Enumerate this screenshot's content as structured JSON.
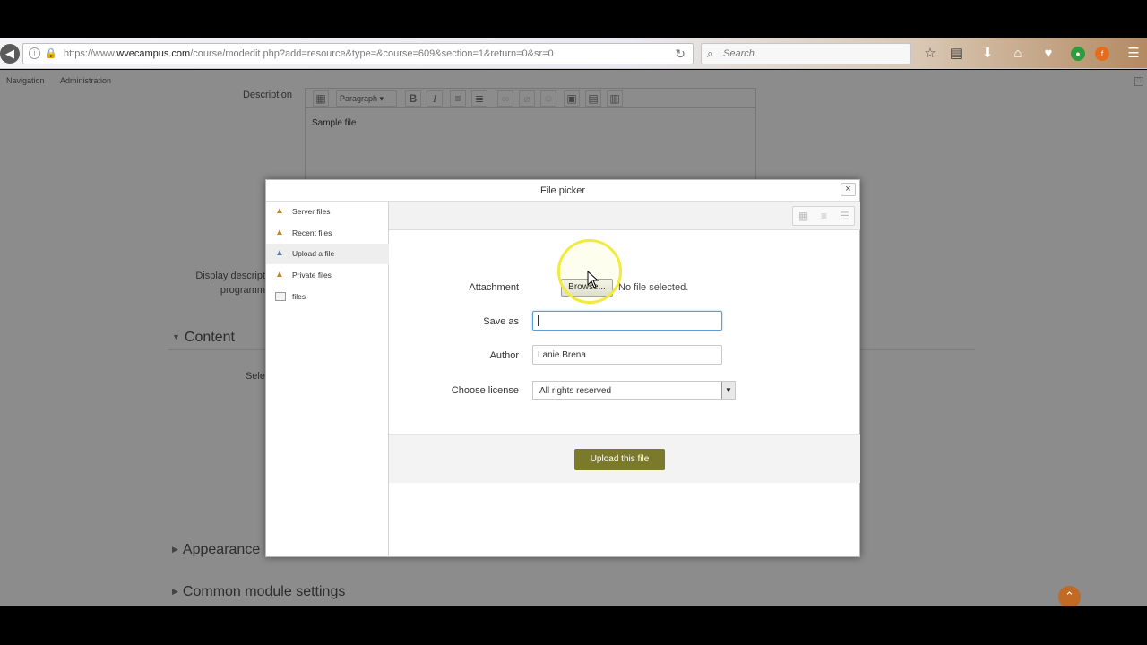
{
  "browser": {
    "url_prefix": "https://www.",
    "url_domain": "wvecampus.com",
    "url_path": "/course/modedit.php?add=resource&type=&course=609&section=1&return=0&sr=0",
    "search_placeholder": "Search"
  },
  "navbar": {
    "navigation": "Navigation",
    "administration": "Administration"
  },
  "form": {
    "description_label": "Description",
    "editor_paragraph": "Paragraph",
    "editor_content": "Sample file",
    "display_description_label_line1": "Display descript",
    "display_description_label_line2": "programm",
    "content_section": "Content",
    "select_label": "Sele",
    "appearance_section": "Appearance",
    "common_module_section": "Common module settings"
  },
  "file_picker": {
    "title": "File picker",
    "close": "×",
    "repositories": [
      {
        "label": "Server files",
        "icon": "server-files-icon",
        "active": false
      },
      {
        "label": "Recent files",
        "icon": "recent-files-icon",
        "active": false
      },
      {
        "label": "Upload a file",
        "icon": "upload-file-icon",
        "active": true
      },
      {
        "label": "Private files",
        "icon": "private-files-icon",
        "active": false
      },
      {
        "label": "files",
        "icon": "files-icon",
        "active": false
      }
    ],
    "upload": {
      "attachment_label": "Attachment",
      "browse_button": "Browse...",
      "no_file": "No file selected.",
      "save_as_label": "Save as",
      "save_as_value": "",
      "author_label": "Author",
      "author_value": "Lanie Brena",
      "license_label": "Choose license",
      "license_value": "All rights reserved",
      "upload_button": "Upload this file"
    }
  },
  "colors": {
    "upload_button": "#7a7a2a",
    "overlay_page": "#8c8c8c",
    "scroll_top": "#c06a26",
    "click_highlight": "#f2ea3c"
  }
}
